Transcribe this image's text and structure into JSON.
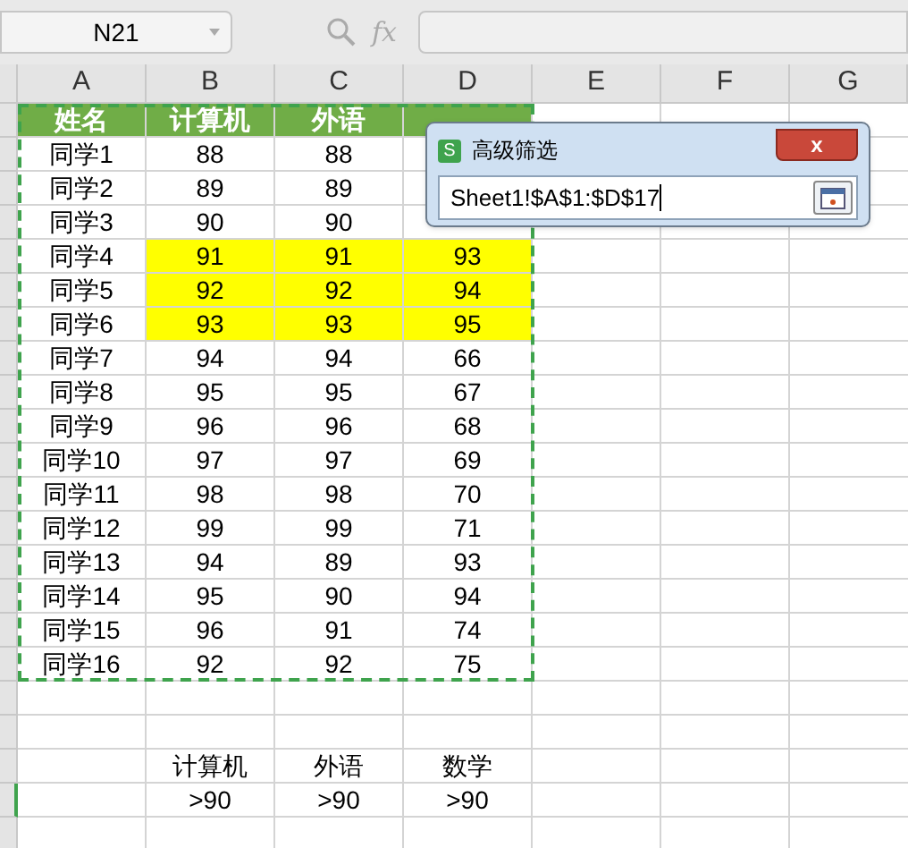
{
  "name_box": "N21",
  "fx": "fx",
  "columns": [
    "A",
    "B",
    "C",
    "D",
    "E",
    "F",
    "G"
  ],
  "header": [
    "姓名",
    "计算机",
    "外语"
  ],
  "rows": [
    {
      "cells": [
        "同学1",
        "88",
        "88"
      ],
      "highlighted": false
    },
    {
      "cells": [
        "同学2",
        "89",
        "89"
      ],
      "highlighted": false
    },
    {
      "cells": [
        "同学3",
        "90",
        "90"
      ],
      "highlighted": false
    },
    {
      "cells": [
        "同学4",
        "91",
        "91",
        "93"
      ],
      "highlighted": true
    },
    {
      "cells": [
        "同学5",
        "92",
        "92",
        "94"
      ],
      "highlighted": true
    },
    {
      "cells": [
        "同学6",
        "93",
        "93",
        "95"
      ],
      "highlighted": true
    },
    {
      "cells": [
        "同学7",
        "94",
        "94",
        "66"
      ],
      "highlighted": false
    },
    {
      "cells": [
        "同学8",
        "95",
        "95",
        "67"
      ],
      "highlighted": false
    },
    {
      "cells": [
        "同学9",
        "96",
        "96",
        "68"
      ],
      "highlighted": false
    },
    {
      "cells": [
        "同学10",
        "97",
        "97",
        "69"
      ],
      "highlighted": false
    },
    {
      "cells": [
        "同学11",
        "98",
        "98",
        "70"
      ],
      "highlighted": false
    },
    {
      "cells": [
        "同学12",
        "99",
        "99",
        "71"
      ],
      "highlighted": false
    },
    {
      "cells": [
        "同学13",
        "94",
        "89",
        "93"
      ],
      "highlighted": false
    },
    {
      "cells": [
        "同学14",
        "95",
        "90",
        "94"
      ],
      "highlighted": false
    },
    {
      "cells": [
        "同学15",
        "96",
        "91",
        "74"
      ],
      "highlighted": false
    },
    {
      "cells": [
        "同学16",
        "92",
        "92",
        "75"
      ],
      "highlighted": false
    }
  ],
  "criteria": [
    [
      "计算机",
      "外语",
      "数学"
    ],
    [
      ">90",
      ">90",
      ">90"
    ]
  ],
  "dialog": {
    "icon": "S",
    "title": "高级筛选",
    "close": "x",
    "range": "Sheet1!$A$1:$D$17"
  }
}
